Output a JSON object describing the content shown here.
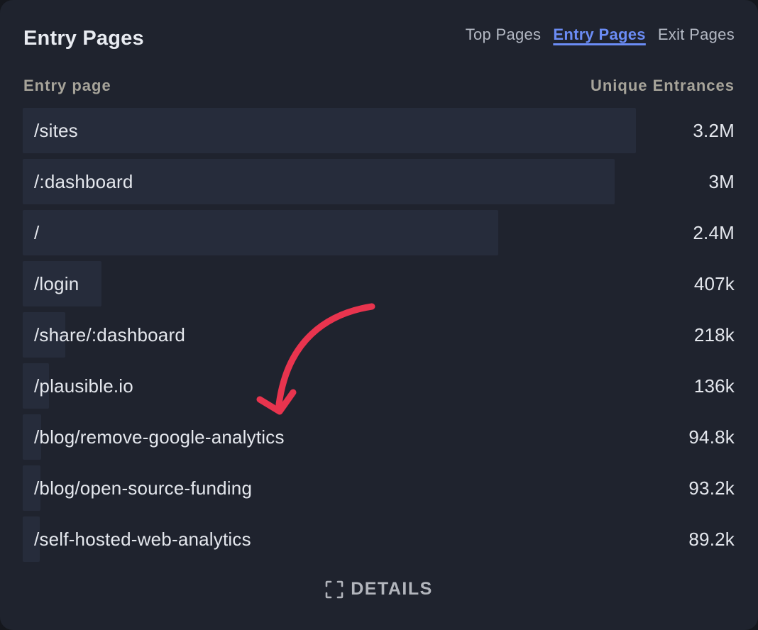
{
  "header": {
    "title": "Entry Pages",
    "tabs": [
      {
        "label": "Top Pages",
        "active": false
      },
      {
        "label": "Entry Pages",
        "active": true
      },
      {
        "label": "Exit Pages",
        "active": false
      }
    ]
  },
  "columns": {
    "left": "Entry page",
    "right": "Unique Entrances"
  },
  "rows": [
    {
      "label": "/sites",
      "value": "3.2M",
      "share": 1.0
    },
    {
      "label": "/:dashboard",
      "value": "3M",
      "share": 0.965
    },
    {
      "label": "/",
      "value": "2.4M",
      "share": 0.775
    },
    {
      "label": "/login",
      "value": "407k",
      "share": 0.128
    },
    {
      "label": "/share/:dashboard",
      "value": "218k",
      "share": 0.069
    },
    {
      "label": "/plausible.io",
      "value": "136k",
      "share": 0.043
    },
    {
      "label": "/blog/remove-google-analytics",
      "value": "94.8k",
      "share": 0.03
    },
    {
      "label": "/blog/open-source-funding",
      "value": "93.2k",
      "share": 0.029
    },
    {
      "label": "/self-hosted-web-analytics",
      "value": "89.2k",
      "share": 0.028
    }
  ],
  "footer": {
    "details_label": "DETAILS",
    "details_icon": "maximize-icon"
  },
  "colors": {
    "panel_bg": "#1f232e",
    "bar": "#262c3b",
    "active_tab": "#6b8cf5",
    "annotation_arrow": "#e8344e"
  }
}
